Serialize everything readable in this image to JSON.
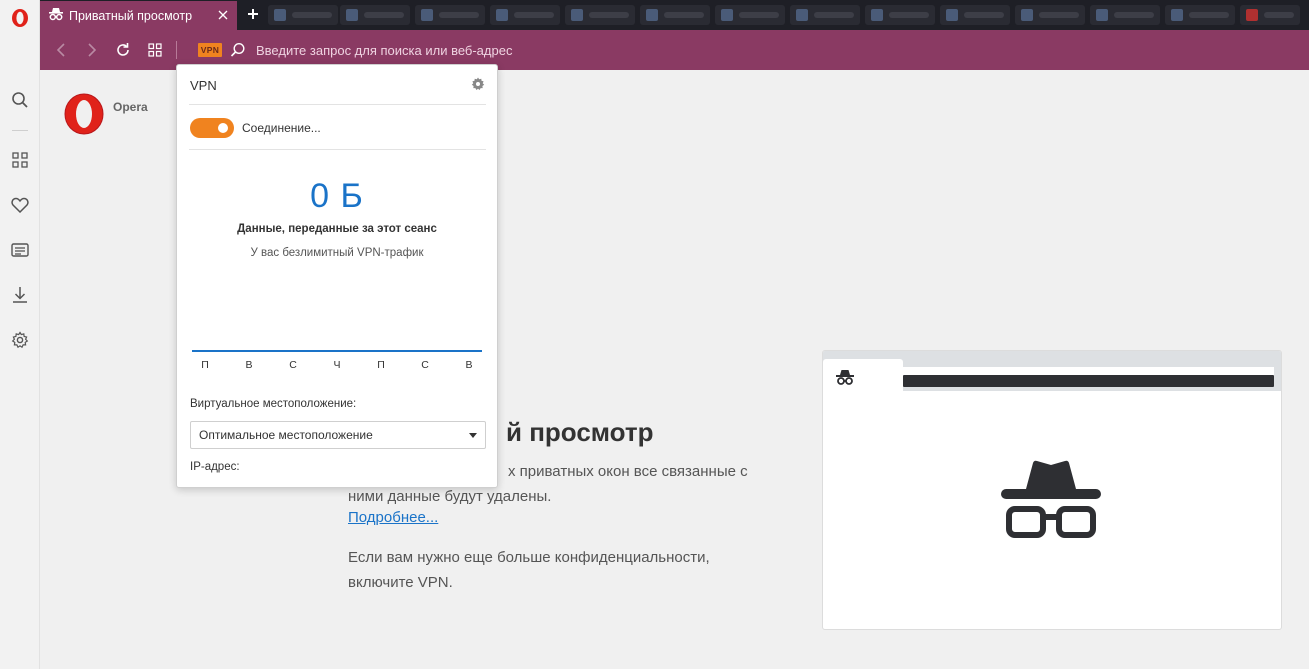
{
  "tab": {
    "title": "Приватный просмотр"
  },
  "toolbar": {
    "vpn_badge": "VPN",
    "address_placeholder": "Введите запрос для поиска или веб-адрес"
  },
  "content": {
    "logo_text": "Opera",
    "heading_partial": "й просмотр",
    "text_1": "х приватных окон все связанные с ними данные будут удалены.",
    "learn_more": "Подробнее...",
    "text_2": "Если вам нужно еще больше конфиденциальности, включите VPN."
  },
  "vpn_popup": {
    "title": "VPN",
    "toggle_on": true,
    "status": "Соединение...",
    "data_value": "0 Б",
    "data_label": "Данные, переданные за этот сеанс",
    "unlimited_note": "У вас безлимитный VPN-трафик",
    "days": [
      "П",
      "В",
      "С",
      "Ч",
      "П",
      "С",
      "В"
    ],
    "location_label": "Виртуальное местоположение:",
    "location_value": "Оптимальное местоположение",
    "ip_label": "IP-адрес:"
  },
  "colors": {
    "accent": "#8a3a63",
    "vpn_orange": "#f0831f",
    "link_blue": "#1a73c8",
    "opera_red": "#e0221a"
  },
  "icons": {
    "opera_menu": "opera-logo-icon",
    "private_tab": "incognito-icon",
    "sidebar": [
      "search-icon",
      "speed-dial-icon",
      "heart-icon",
      "news-icon",
      "download-icon",
      "settings-icon"
    ]
  }
}
